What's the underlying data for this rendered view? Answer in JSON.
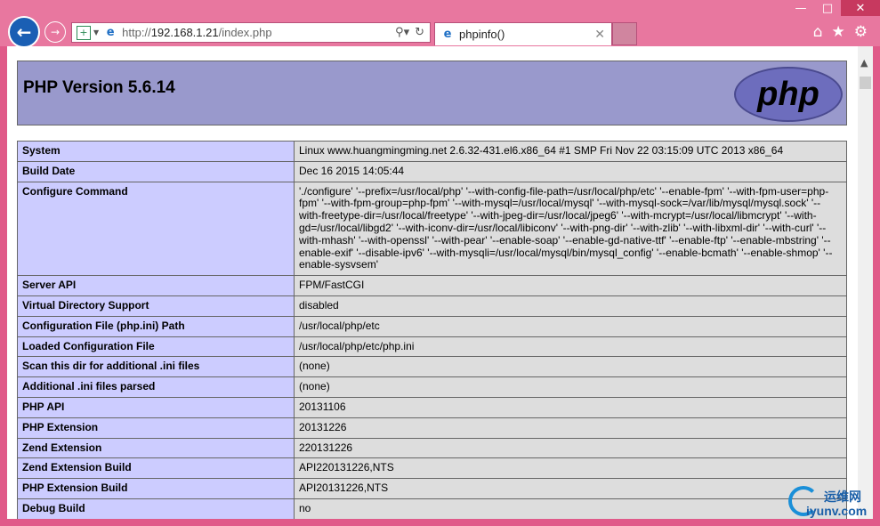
{
  "browser": {
    "url_prefix": "http://",
    "url_host": "192.168.1.21",
    "url_path": "/index.php",
    "tab_title": "phpinfo()",
    "search_icon": "search-icon",
    "refresh_icon": "refresh-icon"
  },
  "page": {
    "heading": "PHP Version 5.6.14",
    "logo_text": "php"
  },
  "rows": [
    {
      "k": "System",
      "v": "Linux www.huangmingming.net 2.6.32-431.el6.x86_64 #1 SMP Fri Nov 22 03:15:09 UTC 2013 x86_64"
    },
    {
      "k": "Build Date",
      "v": "Dec 16 2015 14:05:44"
    },
    {
      "k": "Configure Command",
      "v": "'./configure' '--prefix=/usr/local/php' '--with-config-file-path=/usr/local/php/etc' '--enable-fpm' '--with-fpm-user=php-fpm' '--with-fpm-group=php-fpm' '--with-mysql=/usr/local/mysql' '--with-mysql-sock=/var/lib/mysql/mysql.sock' '--with-freetype-dir=/usr/local/freetype' '--with-jpeg-dir=/usr/local/jpeg6' '--with-mcrypt=/usr/local/libmcrypt' '--with-gd=/usr/local/libgd2' '--with-iconv-dir=/usr/local/libiconv' '--with-png-dir' '--with-zlib' '--with-libxml-dir' '--with-curl' '--with-mhash' '--with-openssl' '--with-pear' '--enable-soap' '--enable-gd-native-ttf' '--enable-ftp' '--enable-mbstring' '--enable-exif' '--disable-ipv6' '--with-mysqli=/usr/local/mysql/bin/mysql_config' '--enable-bcmath' '--enable-shmop' '--enable-sysvsem'"
    },
    {
      "k": "Server API",
      "v": "FPM/FastCGI"
    },
    {
      "k": "Virtual Directory Support",
      "v": "disabled"
    },
    {
      "k": "Configuration File (php.ini) Path",
      "v": "/usr/local/php/etc"
    },
    {
      "k": "Loaded Configuration File",
      "v": "/usr/local/php/etc/php.ini"
    },
    {
      "k": "Scan this dir for additional .ini files",
      "v": "(none)"
    },
    {
      "k": "Additional .ini files parsed",
      "v": "(none)"
    },
    {
      "k": "PHP API",
      "v": "20131106"
    },
    {
      "k": "PHP Extension",
      "v": "20131226"
    },
    {
      "k": "Zend Extension",
      "v": "220131226"
    },
    {
      "k": "Zend Extension Build",
      "v": "API220131226,NTS"
    },
    {
      "k": "PHP Extension Build",
      "v": "API20131226,NTS"
    },
    {
      "k": "Debug Build",
      "v": "no"
    }
  ],
  "watermark": {
    "cn": "运维网",
    "en": "iyunv.com"
  }
}
